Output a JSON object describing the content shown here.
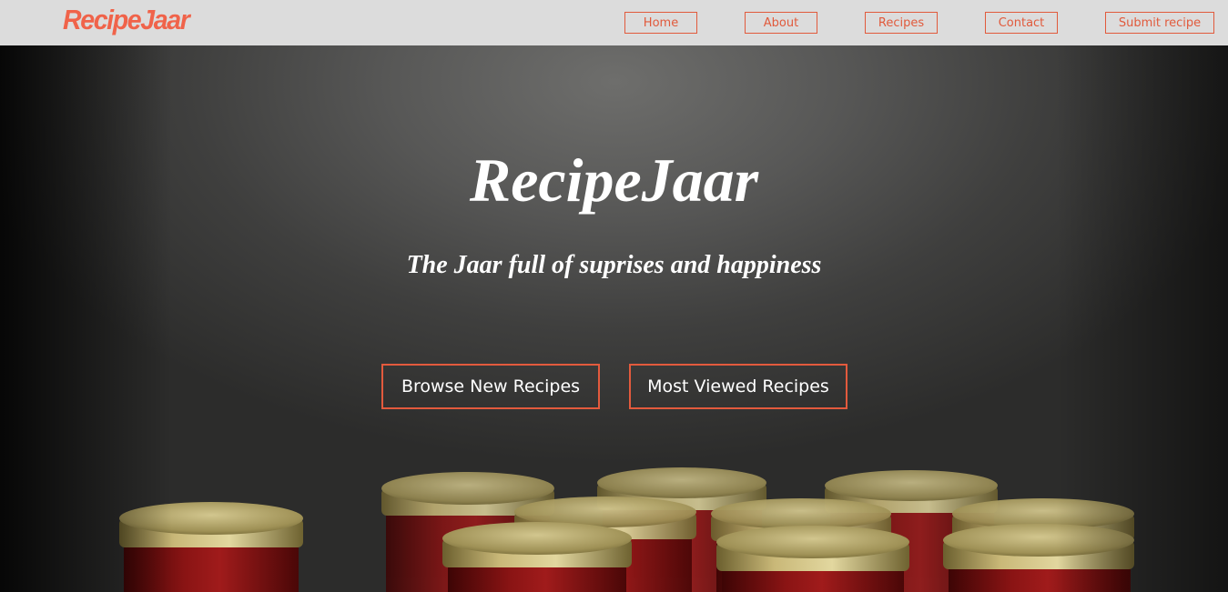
{
  "brand": {
    "logo_text": "RecipeJaar",
    "color": "#f0634a"
  },
  "nav": {
    "items": [
      {
        "label": "Home"
      },
      {
        "label": "About"
      },
      {
        "label": "Recipes"
      },
      {
        "label": "Contact"
      },
      {
        "label": "Submit recipe"
      }
    ]
  },
  "hero": {
    "title": "RecipeJaar",
    "subtitle": "The Jaar full of suprises and happiness",
    "buttons": {
      "browse_label": "Browse New Recipes",
      "most_viewed_label": "Most Viewed Recipes"
    },
    "image": "jam-jars-photo"
  },
  "colors": {
    "accent": "#e15a3c",
    "navbar_bg": "#dcdcdc",
    "hero_text": "#ffffff",
    "jam": "#7a0f0f",
    "lid": "#b8a763"
  }
}
